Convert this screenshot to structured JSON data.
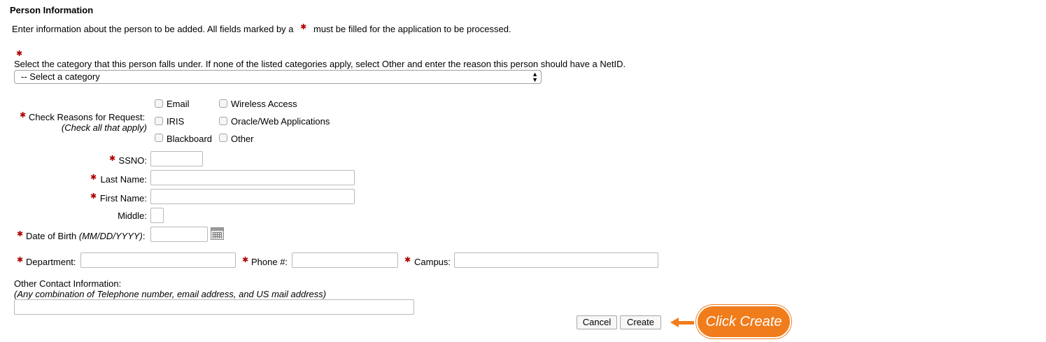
{
  "section_title": "Person Information",
  "intro": {
    "before": "Enter information about the person to be added.  All fields marked by a",
    "after": "must be filled for the application to be processed."
  },
  "required_marker": "✱",
  "category": {
    "prompt": "Select the category that this person falls under. If none of the listed categories apply, select Other and enter the reason this person should have a NetID.",
    "selected": "-- Select a category"
  },
  "reasons": {
    "label": "Check Reasons for Request:",
    "hint": "(Check all that apply)",
    "options": [
      "Email",
      "IRIS",
      "Blackboard",
      "Wireless Access",
      "Oracle/Web Applications",
      "Other"
    ]
  },
  "fields": {
    "ssno": "SSNO:",
    "last_name": "Last Name:",
    "first_name": "First Name:",
    "middle": "Middle:",
    "dob_label": "Date of Birth",
    "dob_format": "(MM/DD/YYYY)",
    "dob_colon": ":",
    "department": "Department:",
    "phone": "Phone #:",
    "campus": "Campus:"
  },
  "other_contact": {
    "label": "Other Contact Information:",
    "hint": "(Any combination of Telephone number, email address, and US mail address)"
  },
  "buttons": {
    "cancel": "Cancel",
    "create": "Create"
  },
  "callout": {
    "text": "Click Create",
    "color": "#f07c1c"
  }
}
